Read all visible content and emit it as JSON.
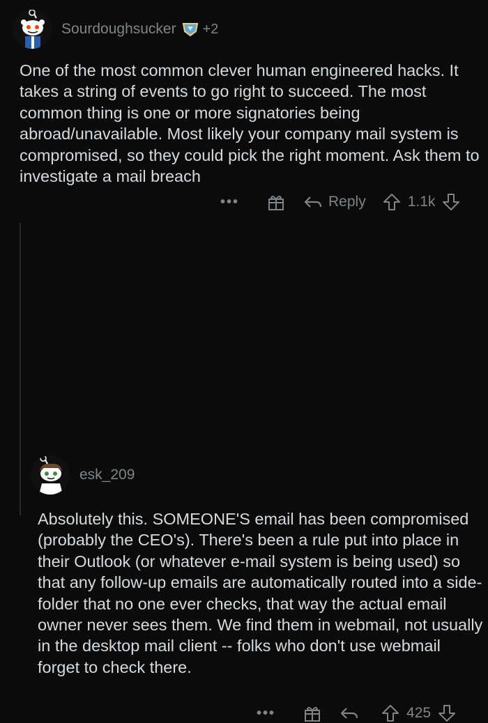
{
  "comments": [
    {
      "username": "Sourdoughsucker",
      "karma": "+2",
      "body": "One of the most common clever human engineered hacks. It takes a string of events to go right to succeed. The most common thing is one or more signatories being abroad/unavailable. Most likely your company mail system is compromised, so they could pick the right moment. Ask them to investigate a mail breach",
      "more_label": "•••",
      "reply_label": "Reply",
      "score": "1.1k"
    },
    {
      "username": "esk_209",
      "body": "Absolutely this.  SOMEONE'S email has been compromised (probably the CEO's).  There's been a rule put into place in their Outlook (or whatever e-mail system is being used) so that any follow-up emails are automatically routed into a side-folder that no one ever checks, that way the actual email owner never sees them.  We find them in webmail, not usually in the desktop mail client -- folks who don't use webmail forget to check there.",
      "more_label": "•••",
      "score": "425"
    }
  ],
  "colors": {
    "background": "#0b0b0b",
    "text": "#d7dadc",
    "muted": "#818384"
  }
}
